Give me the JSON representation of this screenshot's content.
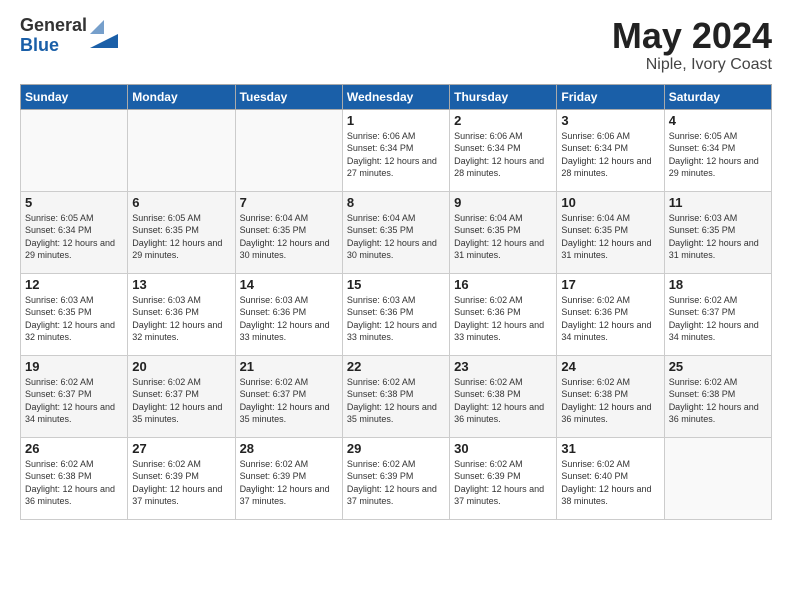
{
  "logo": {
    "general": "General",
    "blue": "Blue"
  },
  "title": "May 2024",
  "location": "Niple, Ivory Coast",
  "days_header": [
    "Sunday",
    "Monday",
    "Tuesday",
    "Wednesday",
    "Thursday",
    "Friday",
    "Saturday"
  ],
  "weeks": [
    [
      {
        "day": "",
        "sunrise": "",
        "sunset": "",
        "daylight": ""
      },
      {
        "day": "",
        "sunrise": "",
        "sunset": "",
        "daylight": ""
      },
      {
        "day": "",
        "sunrise": "",
        "sunset": "",
        "daylight": ""
      },
      {
        "day": "1",
        "sunrise": "Sunrise: 6:06 AM",
        "sunset": "Sunset: 6:34 PM",
        "daylight": "Daylight: 12 hours and 27 minutes."
      },
      {
        "day": "2",
        "sunrise": "Sunrise: 6:06 AM",
        "sunset": "Sunset: 6:34 PM",
        "daylight": "Daylight: 12 hours and 28 minutes."
      },
      {
        "day": "3",
        "sunrise": "Sunrise: 6:06 AM",
        "sunset": "Sunset: 6:34 PM",
        "daylight": "Daylight: 12 hours and 28 minutes."
      },
      {
        "day": "4",
        "sunrise": "Sunrise: 6:05 AM",
        "sunset": "Sunset: 6:34 PM",
        "daylight": "Daylight: 12 hours and 29 minutes."
      }
    ],
    [
      {
        "day": "5",
        "sunrise": "Sunrise: 6:05 AM",
        "sunset": "Sunset: 6:34 PM",
        "daylight": "Daylight: 12 hours and 29 minutes."
      },
      {
        "day": "6",
        "sunrise": "Sunrise: 6:05 AM",
        "sunset": "Sunset: 6:35 PM",
        "daylight": "Daylight: 12 hours and 29 minutes."
      },
      {
        "day": "7",
        "sunrise": "Sunrise: 6:04 AM",
        "sunset": "Sunset: 6:35 PM",
        "daylight": "Daylight: 12 hours and 30 minutes."
      },
      {
        "day": "8",
        "sunrise": "Sunrise: 6:04 AM",
        "sunset": "Sunset: 6:35 PM",
        "daylight": "Daylight: 12 hours and 30 minutes."
      },
      {
        "day": "9",
        "sunrise": "Sunrise: 6:04 AM",
        "sunset": "Sunset: 6:35 PM",
        "daylight": "Daylight: 12 hours and 31 minutes."
      },
      {
        "day": "10",
        "sunrise": "Sunrise: 6:04 AM",
        "sunset": "Sunset: 6:35 PM",
        "daylight": "Daylight: 12 hours and 31 minutes."
      },
      {
        "day": "11",
        "sunrise": "Sunrise: 6:03 AM",
        "sunset": "Sunset: 6:35 PM",
        "daylight": "Daylight: 12 hours and 31 minutes."
      }
    ],
    [
      {
        "day": "12",
        "sunrise": "Sunrise: 6:03 AM",
        "sunset": "Sunset: 6:35 PM",
        "daylight": "Daylight: 12 hours and 32 minutes."
      },
      {
        "day": "13",
        "sunrise": "Sunrise: 6:03 AM",
        "sunset": "Sunset: 6:36 PM",
        "daylight": "Daylight: 12 hours and 32 minutes."
      },
      {
        "day": "14",
        "sunrise": "Sunrise: 6:03 AM",
        "sunset": "Sunset: 6:36 PM",
        "daylight": "Daylight: 12 hours and 33 minutes."
      },
      {
        "day": "15",
        "sunrise": "Sunrise: 6:03 AM",
        "sunset": "Sunset: 6:36 PM",
        "daylight": "Daylight: 12 hours and 33 minutes."
      },
      {
        "day": "16",
        "sunrise": "Sunrise: 6:02 AM",
        "sunset": "Sunset: 6:36 PM",
        "daylight": "Daylight: 12 hours and 33 minutes."
      },
      {
        "day": "17",
        "sunrise": "Sunrise: 6:02 AM",
        "sunset": "Sunset: 6:36 PM",
        "daylight": "Daylight: 12 hours and 34 minutes."
      },
      {
        "day": "18",
        "sunrise": "Sunrise: 6:02 AM",
        "sunset": "Sunset: 6:37 PM",
        "daylight": "Daylight: 12 hours and 34 minutes."
      }
    ],
    [
      {
        "day": "19",
        "sunrise": "Sunrise: 6:02 AM",
        "sunset": "Sunset: 6:37 PM",
        "daylight": "Daylight: 12 hours and 34 minutes."
      },
      {
        "day": "20",
        "sunrise": "Sunrise: 6:02 AM",
        "sunset": "Sunset: 6:37 PM",
        "daylight": "Daylight: 12 hours and 35 minutes."
      },
      {
        "day": "21",
        "sunrise": "Sunrise: 6:02 AM",
        "sunset": "Sunset: 6:37 PM",
        "daylight": "Daylight: 12 hours and 35 minutes."
      },
      {
        "day": "22",
        "sunrise": "Sunrise: 6:02 AM",
        "sunset": "Sunset: 6:38 PM",
        "daylight": "Daylight: 12 hours and 35 minutes."
      },
      {
        "day": "23",
        "sunrise": "Sunrise: 6:02 AM",
        "sunset": "Sunset: 6:38 PM",
        "daylight": "Daylight: 12 hours and 36 minutes."
      },
      {
        "day": "24",
        "sunrise": "Sunrise: 6:02 AM",
        "sunset": "Sunset: 6:38 PM",
        "daylight": "Daylight: 12 hours and 36 minutes."
      },
      {
        "day": "25",
        "sunrise": "Sunrise: 6:02 AM",
        "sunset": "Sunset: 6:38 PM",
        "daylight": "Daylight: 12 hours and 36 minutes."
      }
    ],
    [
      {
        "day": "26",
        "sunrise": "Sunrise: 6:02 AM",
        "sunset": "Sunset: 6:38 PM",
        "daylight": "Daylight: 12 hours and 36 minutes."
      },
      {
        "day": "27",
        "sunrise": "Sunrise: 6:02 AM",
        "sunset": "Sunset: 6:39 PM",
        "daylight": "Daylight: 12 hours and 37 minutes."
      },
      {
        "day": "28",
        "sunrise": "Sunrise: 6:02 AM",
        "sunset": "Sunset: 6:39 PM",
        "daylight": "Daylight: 12 hours and 37 minutes."
      },
      {
        "day": "29",
        "sunrise": "Sunrise: 6:02 AM",
        "sunset": "Sunset: 6:39 PM",
        "daylight": "Daylight: 12 hours and 37 minutes."
      },
      {
        "day": "30",
        "sunrise": "Sunrise: 6:02 AM",
        "sunset": "Sunset: 6:39 PM",
        "daylight": "Daylight: 12 hours and 37 minutes."
      },
      {
        "day": "31",
        "sunrise": "Sunrise: 6:02 AM",
        "sunset": "Sunset: 6:40 PM",
        "daylight": "Daylight: 12 hours and 38 minutes."
      },
      {
        "day": "",
        "sunrise": "",
        "sunset": "",
        "daylight": ""
      }
    ]
  ]
}
